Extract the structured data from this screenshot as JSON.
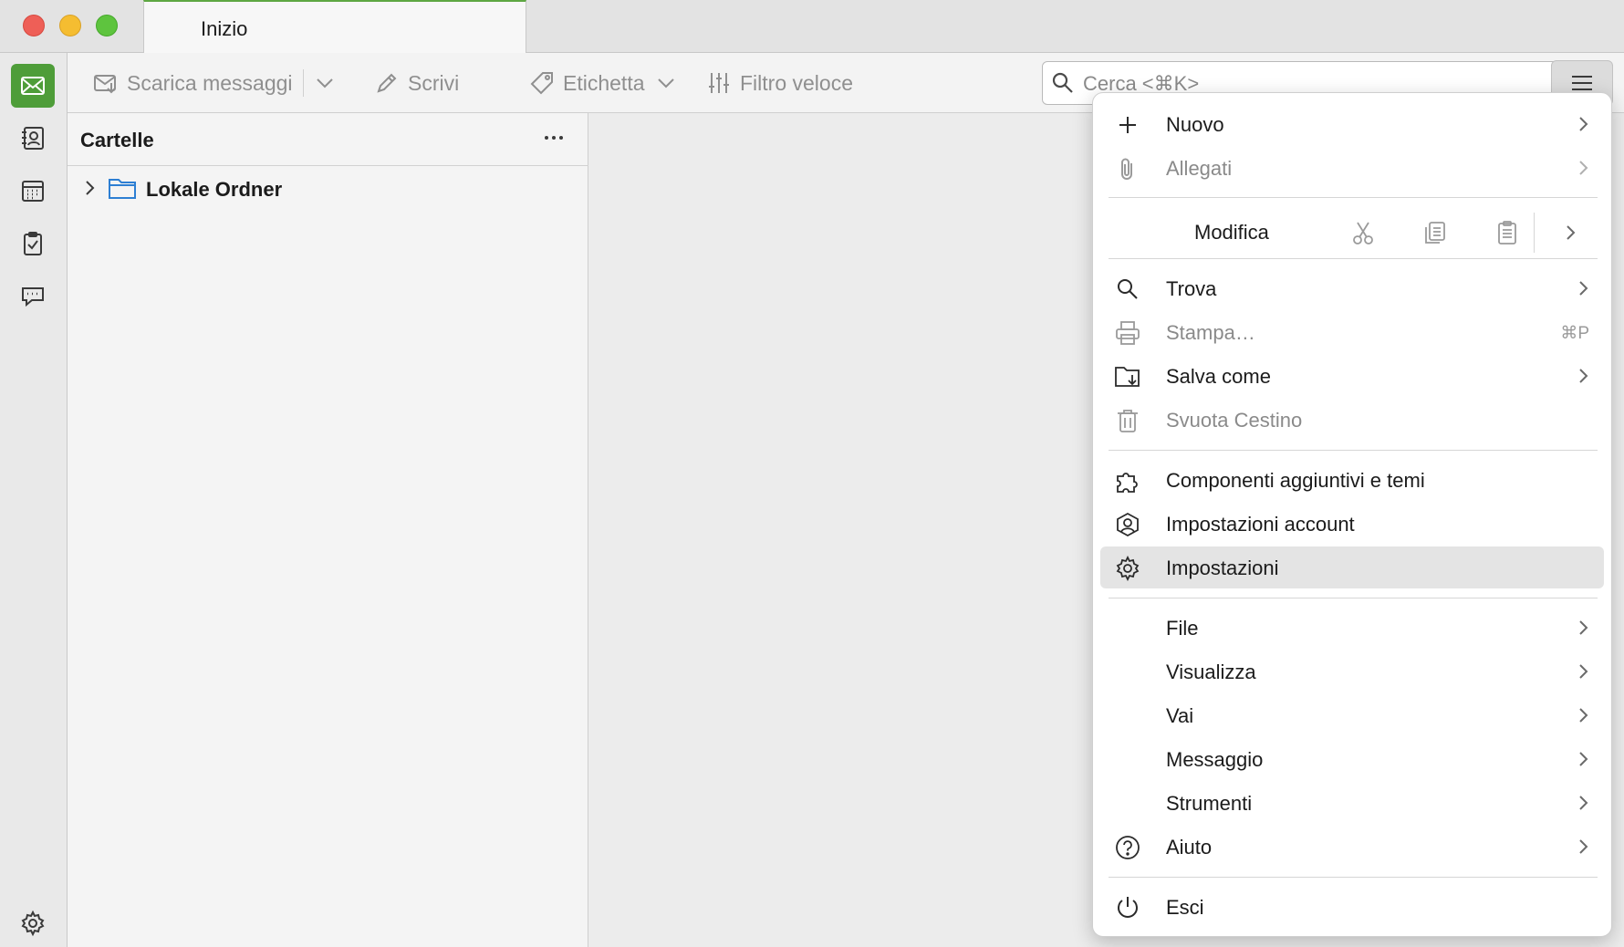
{
  "window": {
    "tab_title": "Inizio"
  },
  "spaces_bar": {
    "items": [
      {
        "name": "mail",
        "icon": "mail-icon",
        "active": true
      },
      {
        "name": "address-book",
        "icon": "address-book-icon",
        "active": false
      },
      {
        "name": "calendar",
        "icon": "calendar-icon",
        "active": false
      },
      {
        "name": "tasks",
        "icon": "tasks-icon",
        "active": false
      },
      {
        "name": "chat",
        "icon": "chat-icon",
        "active": false
      }
    ],
    "settings_icon": "gear-icon"
  },
  "toolbar": {
    "get_messages_label": "Scarica messaggi",
    "write_label": "Scrivi",
    "tag_label": "Etichetta",
    "quick_filter_label": "Filtro veloce",
    "search_placeholder": "Cerca <⌘K>"
  },
  "folder_pane": {
    "title": "Cartelle",
    "folders": [
      {
        "label": "Lokale Ordner",
        "expanded": false
      }
    ]
  },
  "app_menu": {
    "new_label": "Nuovo",
    "attachments_label": "Allegati",
    "edit_label": "Modifica",
    "find_label": "Trova",
    "print_label": "Stampa…",
    "print_shortcut": "⌘P",
    "save_as_label": "Salva come",
    "empty_trash_label": "Svuota Cestino",
    "addons_label": "Componenti aggiuntivi e temi",
    "account_settings_label": "Impostazioni account",
    "settings_label": "Impostazioni",
    "file_label": "File",
    "view_label": "Visualizza",
    "go_label": "Vai",
    "message_label": "Messaggio",
    "tools_label": "Strumenti",
    "help_label": "Aiuto",
    "quit_label": "Esci"
  },
  "colors": {
    "accent_green": "#4e9d39",
    "tab_indicator": "#5ea742",
    "folder_blue": "#2d7fd3",
    "hover_bg": "#e4e4e4"
  }
}
